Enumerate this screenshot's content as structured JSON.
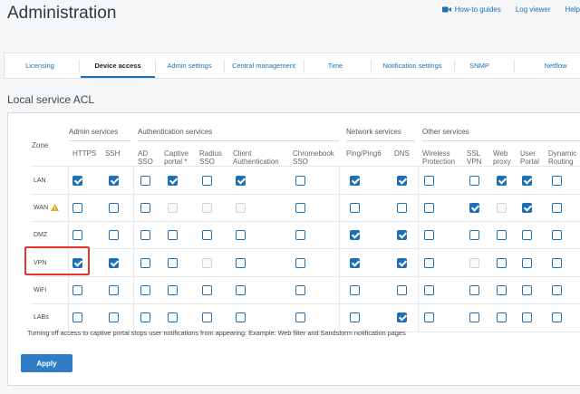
{
  "page_title": "Administration",
  "header_links": [
    {
      "label": "How-to guides",
      "icon": "video-icon"
    },
    {
      "label": "Log viewer"
    },
    {
      "label": "Help"
    }
  ],
  "tabs": [
    {
      "label": "Licensing",
      "active": false
    },
    {
      "label": "Device access",
      "active": true
    },
    {
      "label": "Admin settings",
      "active": false
    },
    {
      "label": "Central management",
      "active": false
    },
    {
      "label": "Time",
      "active": false
    },
    {
      "label": "Notification settings",
      "active": false
    },
    {
      "label": "SNMP",
      "active": false
    },
    {
      "label": "Netflow",
      "active": false
    }
  ],
  "section_title": "Local service ACL",
  "zone_header": "Zone",
  "groups": [
    "Admin services",
    "Authentication services",
    "Network services",
    "Other services"
  ],
  "columns": [
    "HTTPS",
    "SSH",
    "AD\nSSO",
    "Captive\nportal *",
    "Radius\nSSO",
    "Client\nAuthentication",
    "Chromebook\nSSO",
    "Ping/Ping6",
    "DNS",
    "Wireless\nProtection",
    "SSL\nVPN",
    "Web\nproxy",
    "User\nPortal",
    "Dynamic\nRouting"
  ],
  "rows": [
    {
      "zone": "LAN",
      "warning": false,
      "cells": [
        1,
        1,
        0,
        1,
        0,
        1,
        0,
        1,
        1,
        0,
        0,
        1,
        1,
        0
      ]
    },
    {
      "zone": "WAN",
      "warning": true,
      "cells": [
        0,
        0,
        0,
        -1,
        -1,
        -1,
        0,
        0,
        0,
        0,
        1,
        -1,
        1,
        0
      ]
    },
    {
      "zone": "DMZ",
      "warning": false,
      "cells": [
        0,
        0,
        0,
        0,
        0,
        0,
        0,
        1,
        1,
        0,
        0,
        0,
        0,
        0
      ]
    },
    {
      "zone": "VPN",
      "warning": false,
      "cells": [
        1,
        1,
        0,
        0,
        -1,
        0,
        0,
        1,
        1,
        0,
        -1,
        0,
        0,
        0
      ]
    },
    {
      "zone": "WiFi",
      "warning": false,
      "cells": [
        0,
        0,
        0,
        0,
        0,
        0,
        0,
        0,
        0,
        0,
        0,
        0,
        0,
        0
      ]
    },
    {
      "zone": "LABs",
      "warning": false,
      "cells": [
        0,
        0,
        0,
        0,
        0,
        0,
        0,
        0,
        1,
        0,
        0,
        0,
        0,
        0
      ]
    }
  ],
  "note": "Turning off access to captive portal stops user notifications from appearing. Example: Web filter and Sandstorm notification pages",
  "apply_label": "Apply",
  "colors": {
    "accent": "#1d6fb8",
    "highlight": "#e2382b",
    "warning": "#f0a30a"
  }
}
